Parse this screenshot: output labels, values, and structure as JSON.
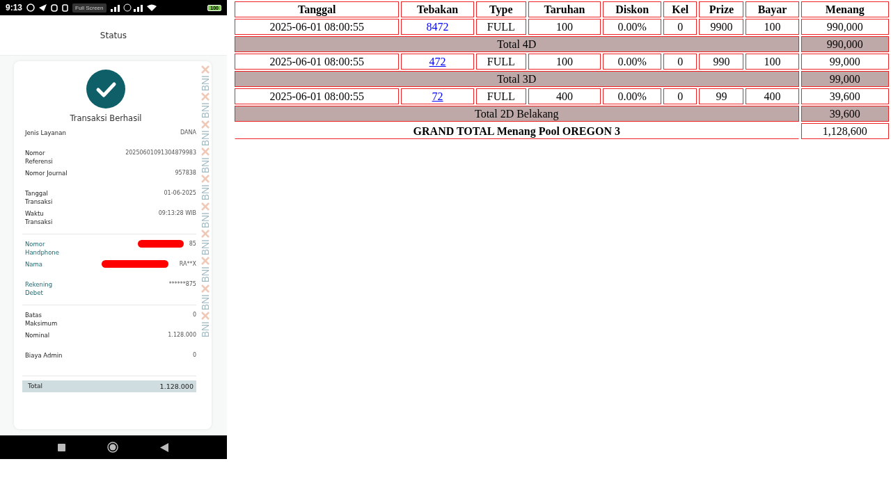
{
  "phone": {
    "status_bar": {
      "time": "9:13",
      "screen_tip": "Full Screen",
      "battery": "100"
    },
    "header": {
      "title": "Status"
    },
    "card": {
      "result": "Transaksi Berhasil",
      "sections": [
        {
          "kind": "plain",
          "rows": [
            {
              "label": "Jenis Layanan",
              "value": "DANA",
              "redacted": false
            },
            {
              "label": "Nomor Referensi",
              "value": "20250601091304879983",
              "redacted": false
            },
            {
              "label": "Nomor Journal",
              "value": "957838",
              "redacted": false
            },
            {
              "label": "Tanggal Transaksi",
              "value": "01-06-2025",
              "redacted": false
            },
            {
              "label": "Waktu Transaksi",
              "value": "09:13:28 WIB",
              "redacted": false
            }
          ]
        },
        {
          "kind": "accent",
          "rows": [
            {
              "label": "Nomor Handphone",
              "value": "85",
              "redacted": true
            },
            {
              "label": "Nama",
              "value": "RA**X",
              "redacted": true
            },
            {
              "label": "Rekening Debet",
              "value": "******875",
              "redacted": false
            }
          ]
        },
        {
          "kind": "plain",
          "rows": [
            {
              "label": "Batas Maksimum",
              "value": "0",
              "redacted": false
            },
            {
              "label": "Nominal",
              "value": "1.128.000",
              "redacted": false
            },
            {
              "label": "Biaya Admin",
              "value": "0",
              "redacted": false
            }
          ]
        }
      ],
      "total": {
        "label": "Total",
        "value": "1.128.000"
      },
      "pattern": [
        "BNI",
        "BNI",
        "BNI",
        "BNI",
        "BNI",
        "BNI",
        "BNI",
        "BNI",
        "BNI",
        "BNI"
      ]
    }
  },
  "table": {
    "columns": [
      "Tanggal",
      "Tebakan",
      "Type",
      "Taruhan",
      "Diskon",
      "Kel",
      "Prize",
      "Bayar",
      "Menang"
    ],
    "rows": [
      {
        "kind": "bet",
        "cells": [
          "2025-06-01 08:00:55",
          "8472",
          "FULL",
          "100",
          "0.00%",
          "0",
          "9900",
          "100",
          "990,000"
        ],
        "underlined": false
      },
      {
        "kind": "total",
        "label": "Total 4D",
        "value": "990,000"
      },
      {
        "kind": "bet",
        "cells": [
          "2025-06-01 08:00:55",
          "472",
          "FULL",
          "100",
          "0.00%",
          "0",
          "990",
          "100",
          "99,000"
        ],
        "underlined": true
      },
      {
        "kind": "total",
        "label": "Total 3D",
        "value": "99,000"
      },
      {
        "kind": "bet",
        "cells": [
          "2025-06-01 08:00:55",
          "72",
          "FULL",
          "400",
          "0.00%",
          "0",
          "99",
          "400",
          "39,600"
        ],
        "underlined": true
      },
      {
        "kind": "total",
        "label": "Total 2D Belakang",
        "value": "39,600"
      },
      {
        "kind": "grand",
        "label": "GRAND TOTAL  Menang Pool OREGON 3",
        "value": "1,128,600"
      }
    ]
  }
}
